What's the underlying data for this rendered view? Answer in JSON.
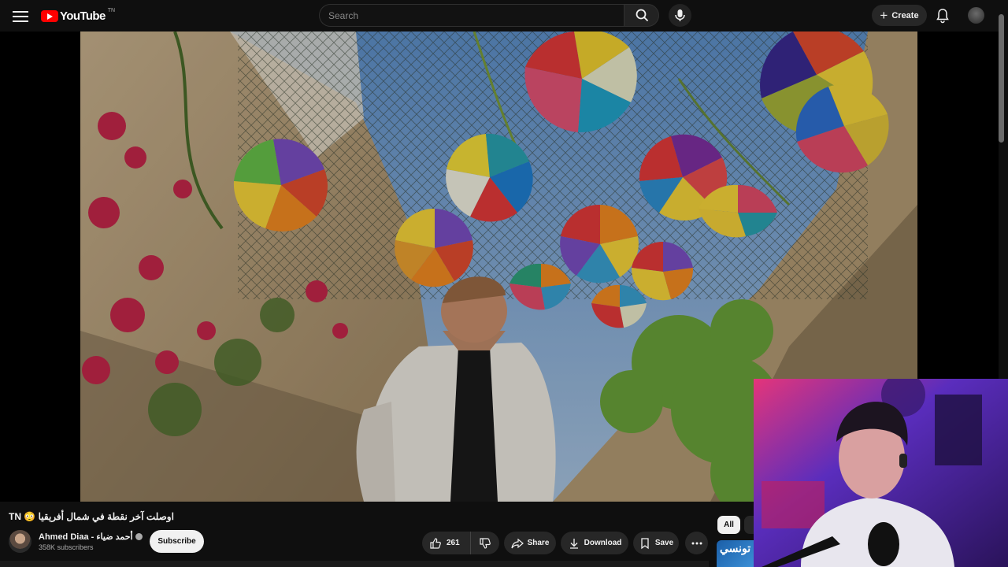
{
  "header": {
    "logo_text": "YouTube",
    "logo_superscript": "TN",
    "search_placeholder": "Search",
    "create_label": "Create"
  },
  "video": {
    "title": "TN 😳 اوصلت آخر نقطة في شمال أفريقيا",
    "channel_name": "Ahmed Diaa - أحمد ضياء",
    "subscribers": "358K subscribers",
    "subscribe_label": "Subscribe",
    "likes": "261",
    "share_label": "Share",
    "download_label": "Download",
    "save_label": "Save"
  },
  "recommendations": {
    "chip_all": "All",
    "thumb_text": "تونسي"
  },
  "colors": {
    "background": "#0f0f0f",
    "brand_red": "#ff0000",
    "button_bg": "#272727"
  },
  "icons": [
    "menu-icon",
    "youtube-logo-icon",
    "search-icon",
    "microphone-icon",
    "plus-icon",
    "bell-icon",
    "verified-icon",
    "like-icon",
    "dislike-icon",
    "share-icon",
    "download-icon",
    "save-icon",
    "more-icon"
  ]
}
